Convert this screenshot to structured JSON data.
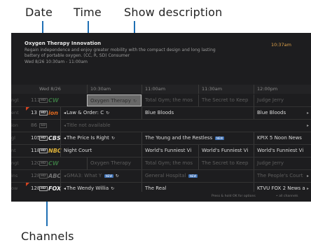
{
  "annotations": {
    "date": "Date",
    "time": "Time",
    "show_description": "Show description",
    "channels": "Channels"
  },
  "info": {
    "title": "Oxygen Therapy Innovation",
    "description": "Regain independence and enjoy greater mobility with the compact design and long lasting battery of portable oxygen. (CC, R, SD) Consumer",
    "airtime": "Wed 8/26 10:30am - 11:00am",
    "clock": "10:37am"
  },
  "grid_header": {
    "date": "Wed 8/26",
    "times": [
      "10:30am",
      "11:00am",
      "11:30am",
      "12:00pm"
    ]
  },
  "rows": [
    {
      "cut": "ngt",
      "number": "111",
      "hd": "HD",
      "logo": "CW",
      "logo_color": "#4fb25a",
      "dim": true,
      "programs": [
        "Oxygen Therapy",
        "Total Gym; the mos",
        "The Secret to Keep",
        "Judge Jerry"
      ],
      "tail": "Ju"
    },
    {
      "cut": "ent",
      "number": "13",
      "hd": "HD",
      "logo": "ion",
      "logo_color": "#e36a1e",
      "dim": false,
      "programs": [
        "Law & Order: C",
        "Blue Bloods",
        "Blue Bloods"
      ],
      "tail": ""
    },
    {
      "cut": "ion",
      "number": "86",
      "hd": "SD",
      "logo": "",
      "logo_color": "#888",
      "dim": true,
      "programs": [
        "Title not available"
      ],
      "tail": ""
    },
    {
      "cut": "gl",
      "number": "105",
      "hd": "HD",
      "logo": "CBS",
      "logo_color": "#e8e8e8",
      "dim": false,
      "programs": [
        "The Price Is Right",
        "The Young and the Restless",
        "KPIX 5 Noon News"
      ],
      "tail": "Th"
    },
    {
      "cut": "nt",
      "number": "118",
      "hd": "HD",
      "logo": "NBC",
      "logo_color": "#e0b43a",
      "dim": false,
      "programs": [
        "Night Court",
        "World's Funniest Vi",
        "World's Funniest Vi",
        "World's Funniest Vi"
      ],
      "tail": "Wo"
    },
    {
      "cut": "ngt",
      "number": "120",
      "hd": "HD",
      "logo": "CW",
      "logo_color": "#4fb25a",
      "dim": true,
      "programs": [
        "Oxygen Therapy",
        "Total Gym; the mos",
        "The Secret to Keep",
        "Judge Jerry"
      ],
      "tail": "Ju"
    },
    {
      "cut": "ins",
      "number": "128",
      "hd": "HD",
      "logo": "ABC",
      "logo_color": "#bcbcbc",
      "dim": true,
      "programs": [
        "GMA3: What Y",
        "General Hospital",
        "The People's Court"
      ],
      "tail": ""
    },
    {
      "cut": "ow",
      "number": "128",
      "hd": "HD",
      "logo": "FOX",
      "logo_color": "#f2f2f2",
      "dim": false,
      "programs": [
        "The Wendy Willia",
        "The Real",
        "KTVU FOX 2 News a"
      ],
      "tail": ""
    }
  ],
  "badges": {
    "new": "NEW"
  },
  "footer": {
    "hint": "Press & hold OK for options",
    "filter": "• all channels"
  }
}
